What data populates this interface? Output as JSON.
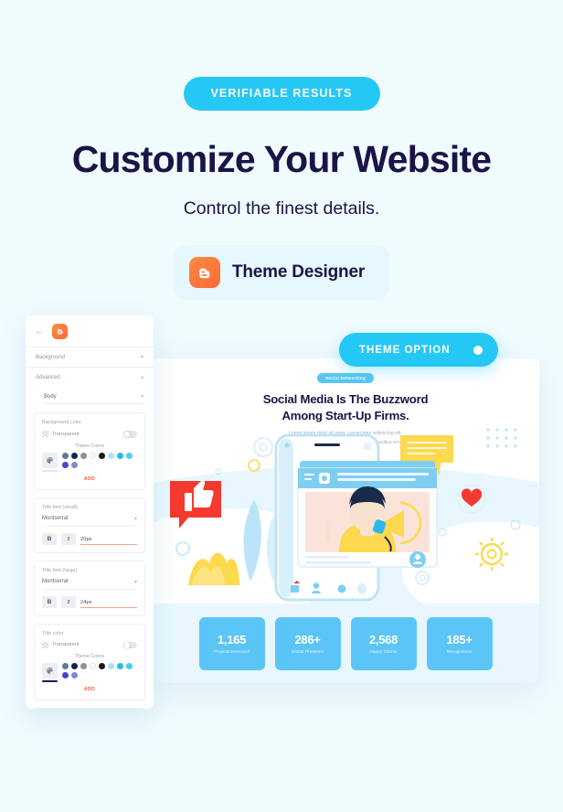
{
  "hero": {
    "badge": "VERIFIABLE RESULTS",
    "title": "Customize Your Website",
    "subtitle": "Control the finest details.",
    "chip_label": "Theme Designer",
    "chip_icon": "blogger-icon",
    "badge_color": "#25c8f5",
    "title_color": "#1b1447",
    "chip_bg": "#e6f7fd"
  },
  "theme_option": {
    "label": "THEME OPTION",
    "color": "#25c8f5"
  },
  "sidebar": {
    "back_icon": "back-arrow-icon",
    "app_icon": "blogger-icon",
    "rows": [
      {
        "label": "Background",
        "caret": "chevron-down-icon"
      },
      {
        "label": "Advanced",
        "caret": "chevron-up-icon"
      }
    ],
    "element_select": {
      "value": "Body",
      "caret": "chevron-down-icon"
    },
    "cards": [
      {
        "title": "Background color",
        "transparent_label": "Transparent",
        "toggle_on": false,
        "theme_colors_label": "Theme Colors",
        "swatches": [
          "#5b7a99",
          "#16204d",
          "#8c8f96",
          "#ffffff",
          "#1a1a1a",
          "#a8e3f7",
          "#2bb8ee",
          "#4ccdf2",
          "#4b45c9",
          "#8189c9"
        ],
        "palette_icon": "color-picker-icon",
        "palette_underline": "#ffffff",
        "add_label": "ADD"
      },
      {
        "title": "Title font (small)",
        "font_name": "Montserrat",
        "bold_label": "B",
        "italic_label": "I",
        "size_value": "20px"
      },
      {
        "title": "Title font (large)",
        "font_name": "Montserrat",
        "bold_label": "B",
        "italic_label": "I",
        "size_value": "24px"
      },
      {
        "title": "Title color",
        "transparent_label": "Transparent",
        "toggle_on": false,
        "theme_colors_label": "Theme Colors",
        "swatches": [
          "#5b7a99",
          "#16204d",
          "#8c8f96",
          "#ffffff",
          "#1a1a1a",
          "#a8e3f7",
          "#2bb8ee",
          "#4ccdf2",
          "#4b45c9",
          "#8189c9"
        ],
        "palette_icon": "color-picker-icon",
        "palette_underline": "#16204d",
        "add_label": "ADD"
      }
    ]
  },
  "preview": {
    "mini_badge": "Social Networking",
    "headline_line1": "Social Media Is The Buzzword",
    "headline_line2": "Among Start-Up Firms.",
    "paragraph_line1": "Lorem ipsum dolor sit amet, consectetur adipiscing elit.",
    "paragraph_line2": "Integer eget est facilisis, cursus felis sed, faucibus eros",
    "illustration": "social-media-phone-illustration",
    "stats": [
      {
        "number": "1,165",
        "label": "Projects Executed"
      },
      {
        "number": "286+",
        "label": "Global Presence"
      },
      {
        "number": "2,568",
        "label": "Happy Clients"
      },
      {
        "number": "185+",
        "label": "Recognitions"
      }
    ],
    "stat_card_color": "#5cc5f7",
    "stats_strip_bg": "#e8f7fe"
  }
}
